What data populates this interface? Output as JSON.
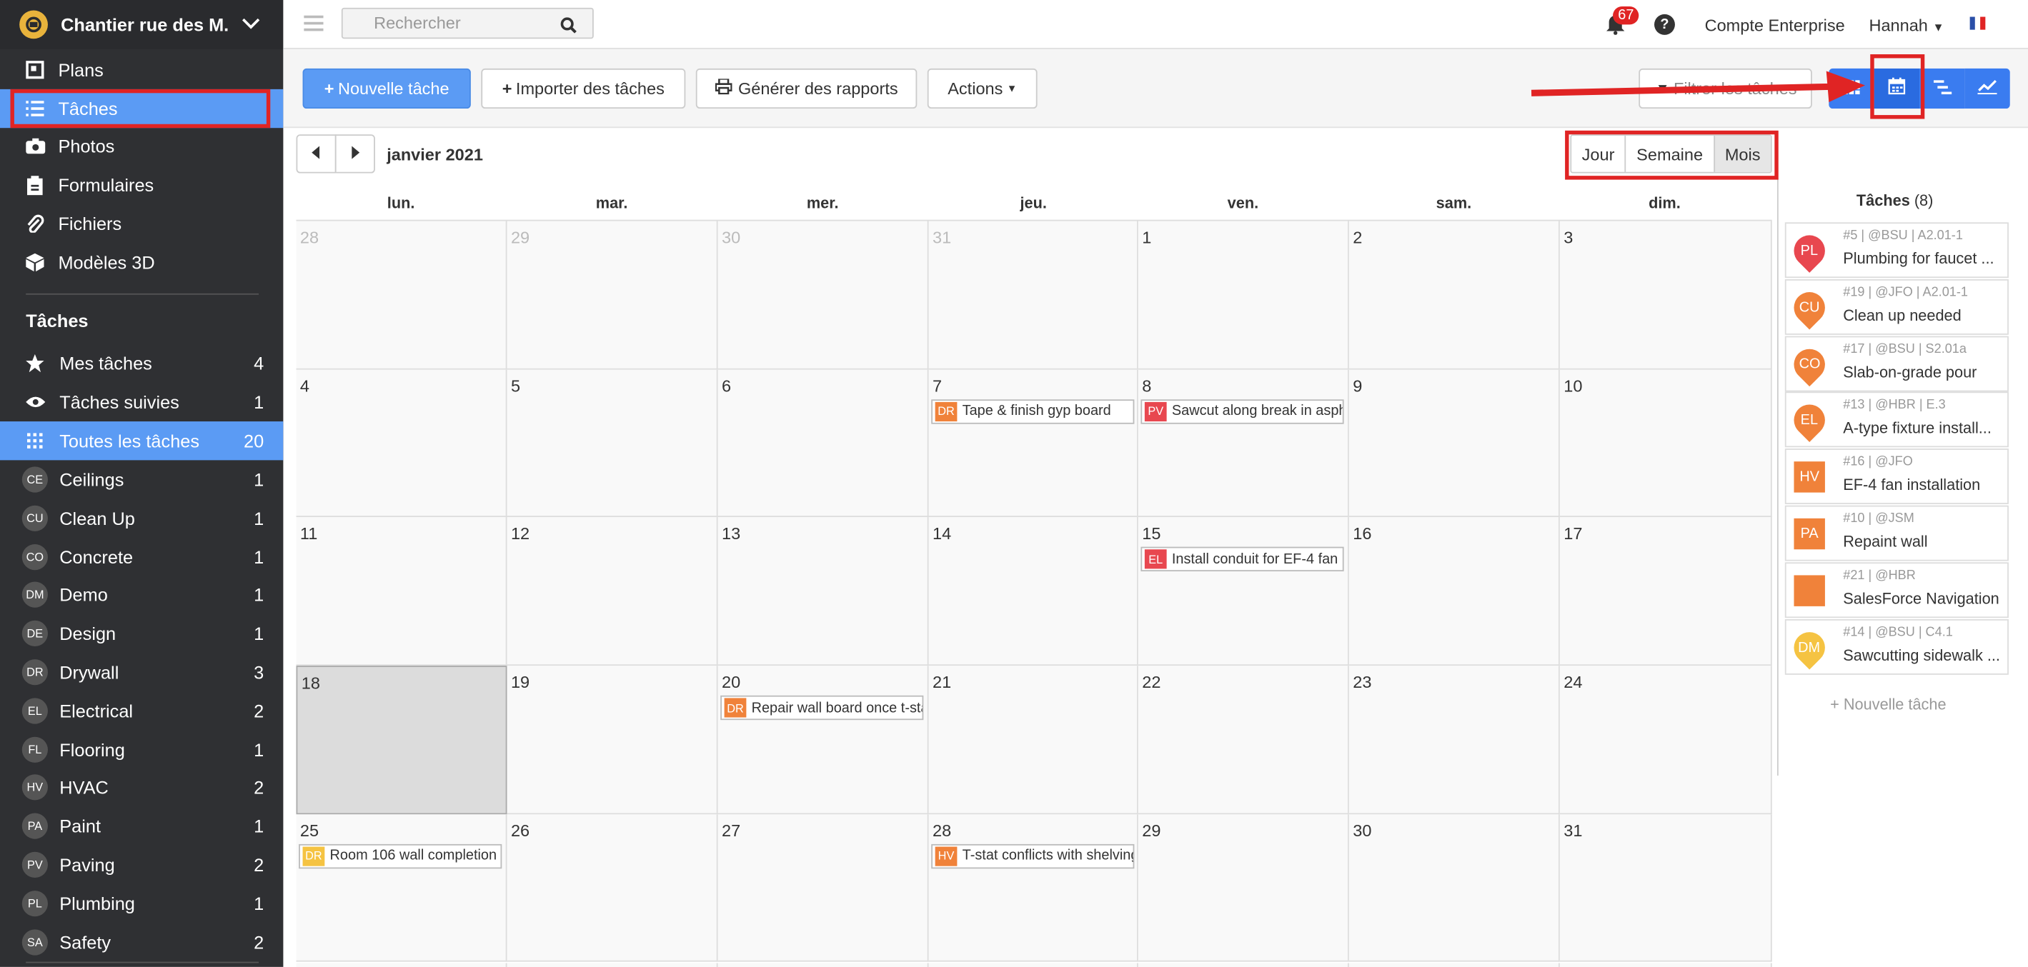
{
  "project": {
    "name": "Chantier rue des M..."
  },
  "nav": [
    {
      "label": "Plans",
      "icon": "plans-icon"
    },
    {
      "label": "Tâches",
      "icon": "list-icon"
    },
    {
      "label": "Photos",
      "icon": "camera-icon"
    },
    {
      "label": "Formulaires",
      "icon": "clipboard-icon"
    },
    {
      "label": "Fichiers",
      "icon": "paperclip-icon"
    },
    {
      "label": "Modèles 3D",
      "icon": "cube-icon"
    }
  ],
  "tasks_section": "Tâches",
  "filters": [
    {
      "label": "Mes tâches",
      "count": "4",
      "icon": "star-icon"
    },
    {
      "label": "Tâches suivies",
      "count": "1",
      "icon": "eye-icon"
    },
    {
      "label": "Toutes les tâches",
      "count": "20",
      "icon": "grid-icon"
    }
  ],
  "categories": [
    {
      "abbr": "CE",
      "label": "Ceilings",
      "count": "1"
    },
    {
      "abbr": "CU",
      "label": "Clean Up",
      "count": "1"
    },
    {
      "abbr": "CO",
      "label": "Concrete",
      "count": "1"
    },
    {
      "abbr": "DM",
      "label": "Demo",
      "count": "1"
    },
    {
      "abbr": "DE",
      "label": "Design",
      "count": "1"
    },
    {
      "abbr": "DR",
      "label": "Drywall",
      "count": "3"
    },
    {
      "abbr": "EL",
      "label": "Electrical",
      "count": "2"
    },
    {
      "abbr": "FL",
      "label": "Flooring",
      "count": "1"
    },
    {
      "abbr": "HV",
      "label": "HVAC",
      "count": "2"
    },
    {
      "abbr": "PA",
      "label": "Paint",
      "count": "1"
    },
    {
      "abbr": "PV",
      "label": "Paving",
      "count": "2"
    },
    {
      "abbr": "PL",
      "label": "Plumbing",
      "count": "1"
    },
    {
      "abbr": "SA",
      "label": "Safety",
      "count": "2"
    }
  ],
  "header": {
    "search_placeholder": "Rechercher",
    "notifications": "67",
    "help": "?",
    "account": "Compte Enterprise",
    "user": "Hannah"
  },
  "toolbar": {
    "new_task": "Nouvelle tâche",
    "import": "Importer des tâches",
    "reports": "Générer des rapports",
    "actions": "Actions",
    "filter": "Filtrer les tâches"
  },
  "calendar": {
    "month": "janvier 2021",
    "modes": [
      "Jour",
      "Semaine",
      "Mois"
    ],
    "weekdays": [
      "lun.",
      "mar.",
      "mer.",
      "jeu.",
      "ven.",
      "sam.",
      "dim."
    ],
    "days": [
      "28",
      "29",
      "30",
      "31",
      "1",
      "2",
      "3",
      "4",
      "5",
      "6",
      "7",
      "8",
      "9",
      "10",
      "11",
      "12",
      "13",
      "14",
      "15",
      "16",
      "17",
      "18",
      "19",
      "20",
      "21",
      "22",
      "23",
      "24",
      "25",
      "26",
      "27",
      "28",
      "29",
      "30",
      "31"
    ],
    "events": [
      {
        "abbr": "DR",
        "title": "Tape & finish gyp board",
        "color": "#f0823a"
      },
      {
        "abbr": "PV",
        "title": "Sawcut along break in aspha",
        "color": "#e8474f"
      },
      {
        "abbr": "EL",
        "title": "Install conduit for EF-4 fan",
        "color": "#e8474f"
      },
      {
        "abbr": "DR",
        "title": "Repair wall board once t-sta",
        "color": "#f0823a"
      },
      {
        "abbr": "DR",
        "title": "Room 106 wall completion",
        "color": "#f5c342"
      },
      {
        "abbr": "HV",
        "title": "T-stat conflicts with shelving",
        "color": "#f0823a"
      }
    ]
  },
  "panel": {
    "title": "Tâches",
    "count": "(8)",
    "tasks": [
      {
        "abbr": "PL",
        "meta": "#5 | @BSU | A2.01-1",
        "title": "Plumbing for faucet ...",
        "color": "#e8474f",
        "shape": "round"
      },
      {
        "abbr": "CU",
        "meta": "#19 | @JFO | A2.01-1",
        "title": "Clean up needed",
        "color": "#f0823a",
        "shape": "round"
      },
      {
        "abbr": "CO",
        "meta": "#17 | @BSU | S2.01a",
        "title": "Slab-on-grade pour",
        "color": "#f0823a",
        "shape": "round"
      },
      {
        "abbr": "EL",
        "meta": "#13 | @HBR | E.3",
        "title": "A-type fixture install...",
        "color": "#f0823a",
        "shape": "round"
      },
      {
        "abbr": "HV",
        "meta": "#16 | @JFO",
        "title": "EF-4 fan installation",
        "color": "#f0823a",
        "shape": "square"
      },
      {
        "abbr": "PA",
        "meta": "#10 | @JSM",
        "title": "Repaint wall",
        "color": "#f0823a",
        "shape": "square"
      },
      {
        "abbr": "",
        "meta": "#21 | @HBR",
        "title": "SalesForce Navigation",
        "color": "#f0823a",
        "shape": "square"
      },
      {
        "abbr": "DM",
        "meta": "#14 | @BSU | C4.1",
        "title": "Sawcutting sidewalk ...",
        "color": "#f5c342",
        "shape": "round"
      }
    ],
    "new_task": "+ Nouvelle tâche"
  },
  "colors": {
    "accent": "#5b9bf4",
    "sidebar": "#2f3033",
    "annotation": "#e02424"
  }
}
